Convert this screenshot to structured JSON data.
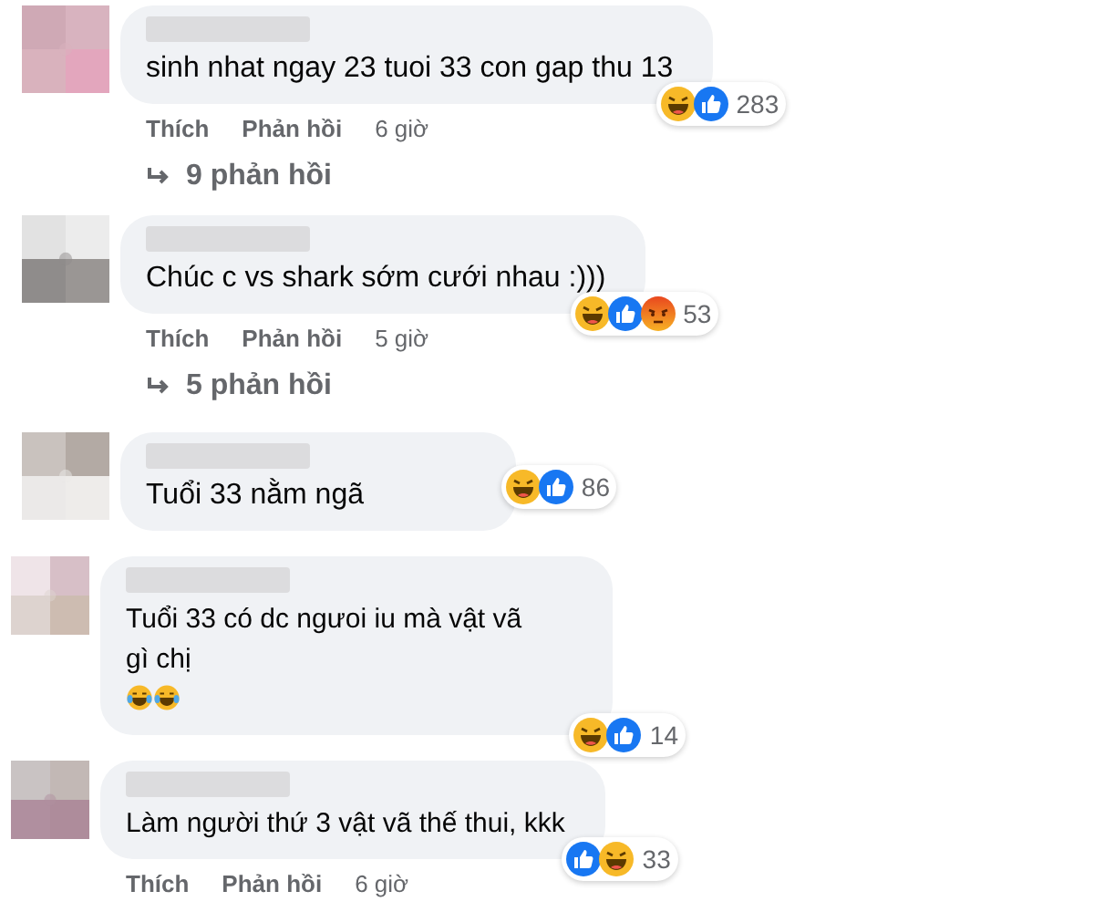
{
  "comments": [
    {
      "avatar": {
        "kind": "picture"
      },
      "text": "sinh nhat ngay 23 tuoi 33 con gap thu 13",
      "reactions": [
        {
          "kind": "haha"
        },
        {
          "kind": "like"
        }
      ],
      "reaction_count": "283",
      "actions": {
        "like": "Thích",
        "reply": "Phản hồi",
        "time": "6 giờ"
      },
      "replies": "9 phản hồi"
    },
    {
      "avatar": {
        "kind": "picture"
      },
      "text": "Chúc c vs shark sớm cưới nhau :)))",
      "reactions": [
        {
          "kind": "haha"
        },
        {
          "kind": "like"
        },
        {
          "kind": "angry"
        }
      ],
      "reaction_count": "53",
      "actions": {
        "like": "Thích",
        "reply": "Phản hồi",
        "time": "5 giờ"
      },
      "replies": "5 phản hồi"
    },
    {
      "avatar": {
        "kind": "picture"
      },
      "text": "Tuổi 33 nằm ngã",
      "reactions": [
        {
          "kind": "haha"
        },
        {
          "kind": "like"
        }
      ],
      "reaction_count": "86"
    },
    {
      "avatar": {
        "kind": "picture"
      },
      "text": "Tuổi 33 có dc ngưoi iu mà vật vã gì chị",
      "trailing_emoji": [
        {
          "kind": "laugh-cry"
        },
        {
          "kind": "laugh-cry"
        }
      ],
      "reactions": [
        {
          "kind": "haha"
        },
        {
          "kind": "like"
        }
      ],
      "reaction_count": "14"
    },
    {
      "avatar": {
        "kind": "picture"
      },
      "text": "Làm người thứ 3 vật vã thế thui, kkk",
      "reactions": [
        {
          "kind": "like"
        },
        {
          "kind": "haha"
        }
      ],
      "reaction_count": "33",
      "actions": {
        "like": "Thích",
        "reply": "Phản hồi",
        "time": "6 giờ"
      }
    }
  ]
}
